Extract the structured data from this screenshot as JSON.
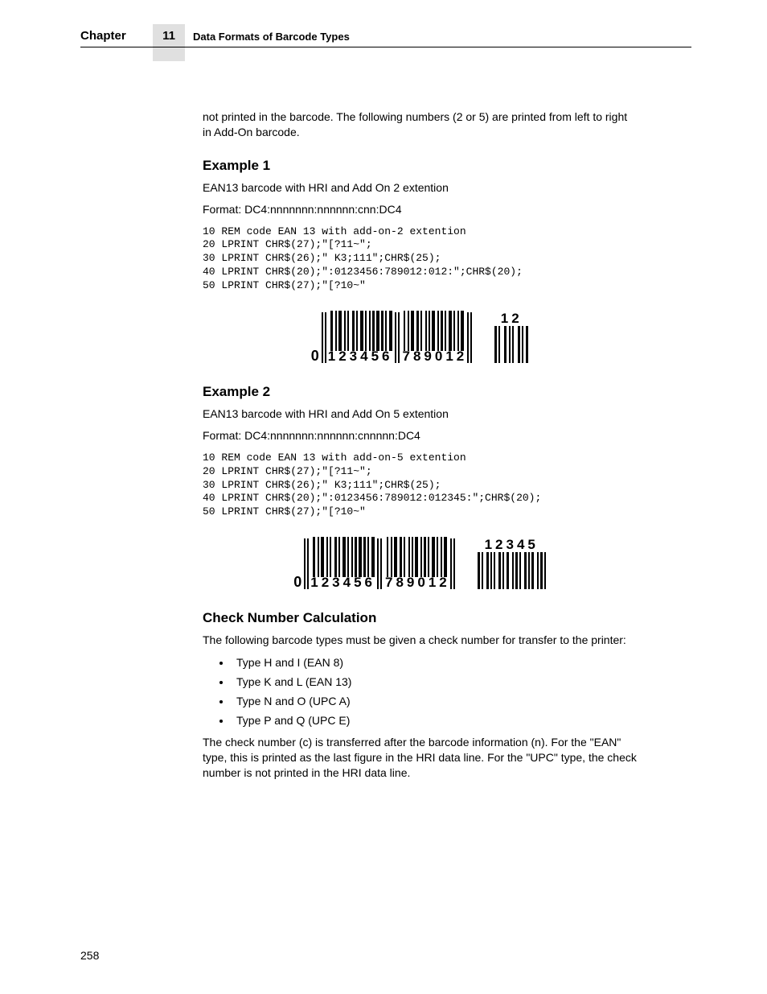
{
  "header": {
    "chapter_label": "Chapter",
    "chapter_number": "11",
    "chapter_title": "Data Formats of Barcode Types"
  },
  "intro_continuation": "not printed in the barcode. The following numbers (2 or 5) are printed from left to right in Add-On barcode.",
  "example1": {
    "heading": "Example 1",
    "desc": "EAN13 barcode with HRI and Add On 2 extention",
    "format": "Format: DC4:nnnnnnn:nnnnnn:cnn:DC4",
    "code": "10 REM code EAN 13 with add-on-2 extention\n20 LPRINT CHR$(27);\"[?11~\";\n30 LPRINT CHR$(26);\" K3;111\";CHR$(25);\n40 LPRINT CHR$(20);\":0123456:789012:012:\";CHR$(20);\n50 LPRINT CHR$(27);\"[?10~\"",
    "barcode": {
      "lead": "0",
      "left_digits": "123456",
      "right_digits": "789012",
      "addon_digits": "12"
    }
  },
  "example2": {
    "heading": "Example 2",
    "desc": "EAN13 barcode with HRI and Add On 5 extention",
    "format": "Format: DC4:nnnnnnn:nnnnnn:cnnnnn:DC4",
    "code": "10 REM code EAN 13 with add-on-5 extention\n20 LPRINT CHR$(27);\"[?11~\";\n30 LPRINT CHR$(26);\" K3;111\";CHR$(25);\n40 LPRINT CHR$(20);\":0123456:789012:012345:\";CHR$(20);\n50 LPRINT CHR$(27);\"[?10~\"",
    "barcode": {
      "lead": "0",
      "left_digits": "123456",
      "right_digits": "789012",
      "addon_digits": "12345"
    }
  },
  "check_section": {
    "heading": "Check Number Calculation",
    "intro": "The following barcode types must be given a check number for transfer to the printer:",
    "bullets": [
      "Type H and I (EAN 8)",
      "Type K and L (EAN 13)",
      "Type N and O (UPC A)",
      "Type P and Q (UPC E)"
    ],
    "outro": "The check number (c) is transferred after the barcode information (n). For the \"EAN\" type, this is printed as the last figure in the HRI data line. For the \"UPC\" type, the check number is not printed in the HRI data line."
  },
  "page_number": "258"
}
